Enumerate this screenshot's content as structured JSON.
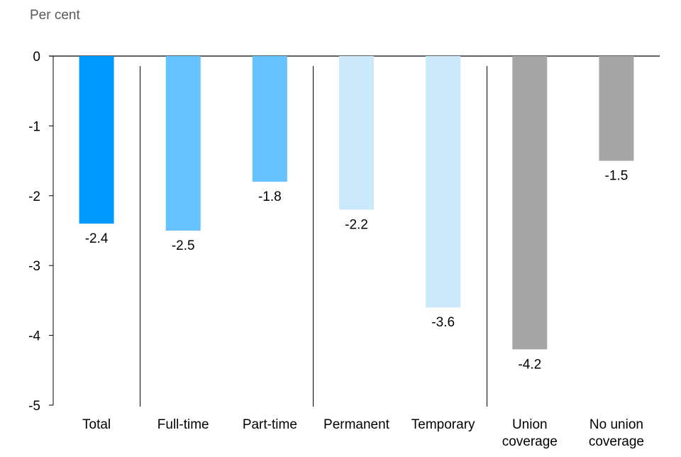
{
  "chart_data": {
    "type": "bar",
    "title": "",
    "ylabel": "Per cent",
    "xlabel": "",
    "ylim": [
      -5,
      0
    ],
    "yticks": [
      0,
      -1,
      -2,
      -3,
      -4,
      -5
    ],
    "ytick_labels": [
      "0",
      "-1",
      "-2",
      "-3",
      "-4",
      "-5"
    ],
    "grid": false,
    "legend": "none",
    "categories": [
      [
        "Total"
      ],
      [
        "Full-time"
      ],
      [
        "Part-time"
      ],
      [
        "Permanent"
      ],
      [
        "Temporary"
      ],
      [
        "Union",
        "coverage"
      ],
      [
        "No union",
        "coverage"
      ]
    ],
    "values": [
      -2.4,
      -2.5,
      -1.8,
      -2.2,
      -3.6,
      -4.2,
      -1.5
    ],
    "data_labels": [
      "-2.4",
      "-2.5",
      "-1.8",
      "-2.2",
      "-3.6",
      "-4.2",
      "-1.5"
    ],
    "bar_colors": [
      "#0099ff",
      "#66c2ff",
      "#66c2ff",
      "#cce9fc",
      "#cce9fc",
      "#a6a6a6",
      "#a6a6a6"
    ],
    "group_separators_after": [
      0,
      2,
      4
    ]
  }
}
